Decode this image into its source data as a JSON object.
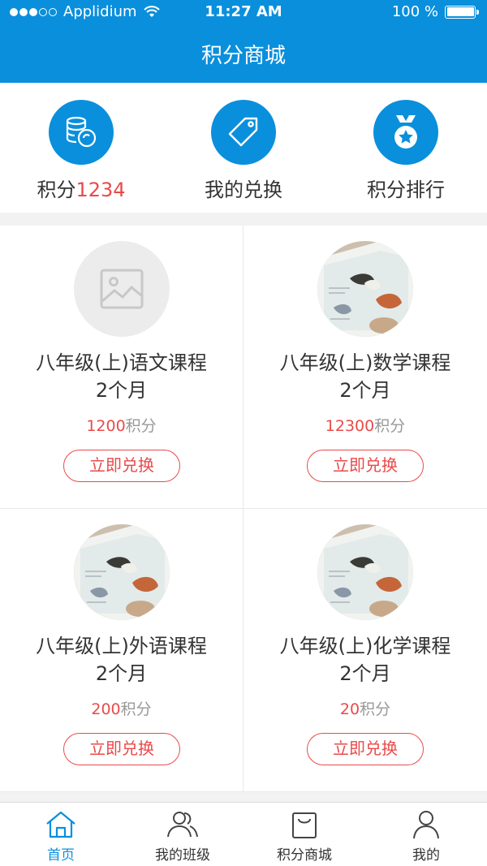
{
  "status_bar": {
    "carrier": "Applidium",
    "time": "11:27 AM",
    "battery": "100 %"
  },
  "header": {
    "title": "积分商城"
  },
  "quick_nav": [
    {
      "label": "积分",
      "value": "1234",
      "icon": "coins-icon"
    },
    {
      "label": "我的兑换",
      "icon": "tag-icon"
    },
    {
      "label": "积分排行",
      "icon": "medal-icon"
    }
  ],
  "products": [
    {
      "title_line1": "八年级(上)语文课程",
      "title_line2": "2个月",
      "points": "1200",
      "points_unit": "积分",
      "button": "立即兑换",
      "image": "placeholder"
    },
    {
      "title_line1": "八年级(上)数学课程",
      "title_line2": "2个月",
      "points": "12300",
      "points_unit": "积分",
      "button": "立即兑换",
      "image": "bird-book"
    },
    {
      "title_line1": "八年级(上)外语课程",
      "title_line2": "2个月",
      "points": "200",
      "points_unit": "积分",
      "button": "立即兑换",
      "image": "bird-book"
    },
    {
      "title_line1": "八年级(上)化学课程",
      "title_line2": "2个月",
      "points": "20",
      "points_unit": "积分",
      "button": "立即兑换",
      "image": "bird-book"
    }
  ],
  "tabbar": [
    {
      "label": "首页",
      "icon": "home-icon",
      "active": true
    },
    {
      "label": "我的班级",
      "icon": "class-icon",
      "active": false
    },
    {
      "label": "积分商城",
      "icon": "shopping-bag-icon",
      "active": false
    },
    {
      "label": "我的",
      "icon": "user-icon",
      "active": false
    }
  ],
  "colors": {
    "primary": "#0a8fdc",
    "accent": "#ea4a4a"
  }
}
